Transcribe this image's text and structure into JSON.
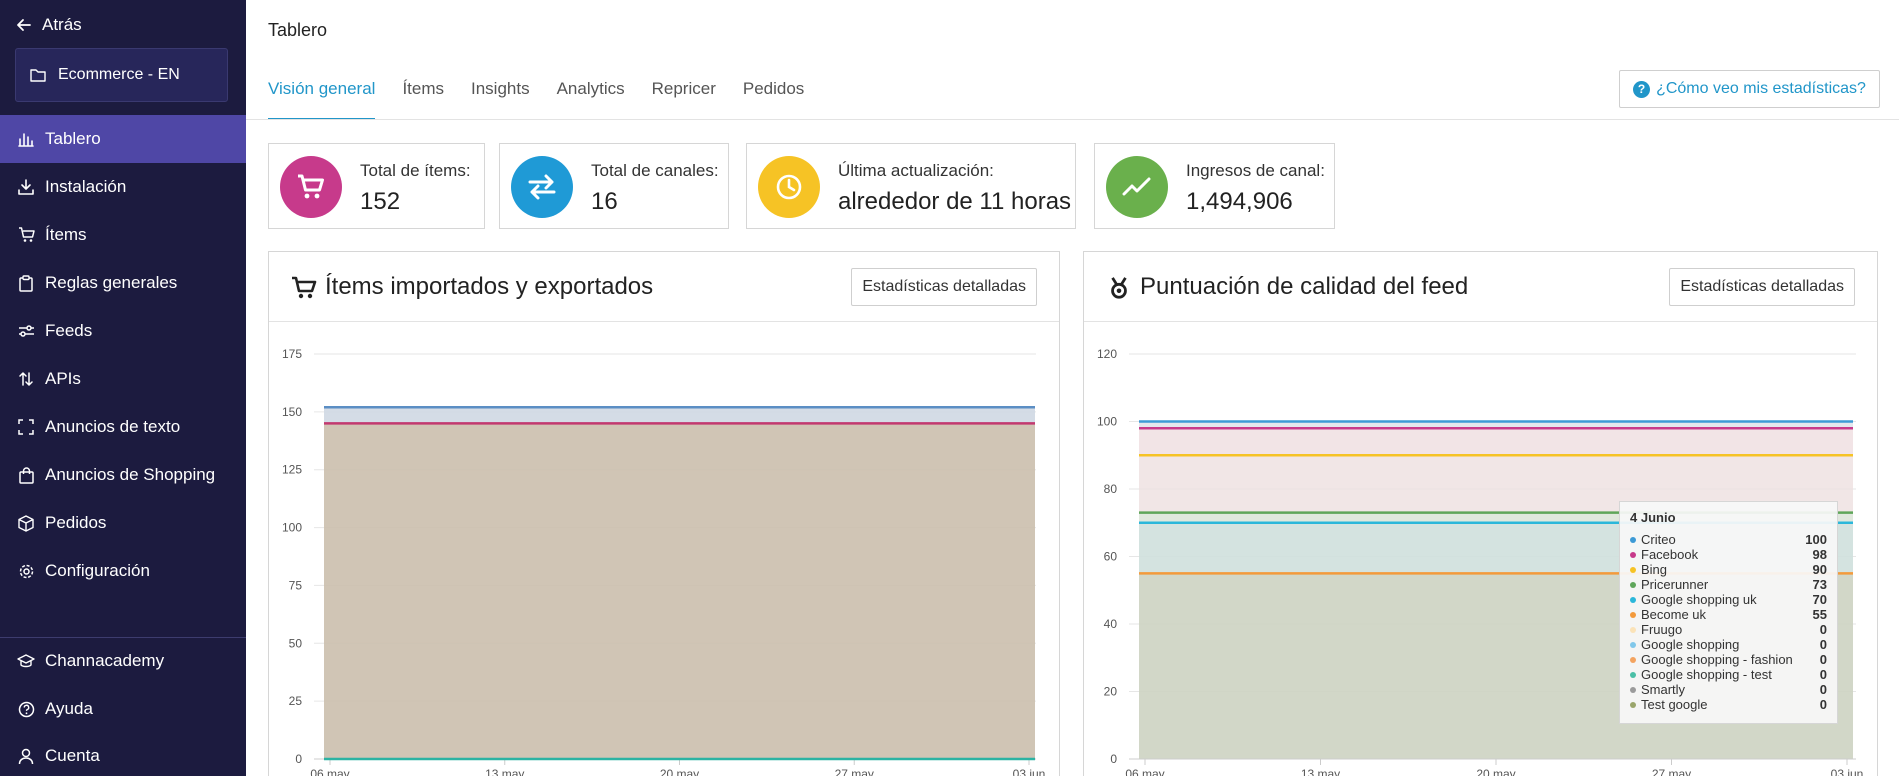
{
  "sidebar": {
    "back_label": "Atrás",
    "workspace": "Ecommerce - EN",
    "items": [
      {
        "label": "Tablero",
        "icon": "bar-chart-icon",
        "active": true
      },
      {
        "label": "Instalación",
        "icon": "download-icon"
      },
      {
        "label": "Ítems",
        "icon": "cart-icon"
      },
      {
        "label": "Reglas generales",
        "icon": "clipboard-icon"
      },
      {
        "label": "Feeds",
        "icon": "sliders-icon"
      },
      {
        "label": "APIs",
        "icon": "sort-arrows-icon"
      },
      {
        "label": "Anuncios de texto",
        "icon": "frame-icon"
      },
      {
        "label": "Anuncios de Shopping",
        "icon": "shopping-bag-icon"
      },
      {
        "label": "Pedidos",
        "icon": "box-icon"
      },
      {
        "label": "Configuración",
        "icon": "gear-icon"
      }
    ],
    "bottom_items": [
      {
        "label": "Channacademy",
        "icon": "graduation-cap-icon"
      },
      {
        "label": "Ayuda",
        "icon": "help-circle-icon"
      },
      {
        "label": "Cuenta",
        "icon": "user-icon"
      }
    ]
  },
  "header": {
    "title": "Tablero",
    "tabs": [
      {
        "label": "Visión general",
        "active": true
      },
      {
        "label": "Ítems"
      },
      {
        "label": "Insights"
      },
      {
        "label": "Analytics"
      },
      {
        "label": "Repricer"
      },
      {
        "label": "Pedidos"
      }
    ],
    "help_button": "¿Cómo veo mis estadísticas?"
  },
  "stats": [
    {
      "label": "Total de ítems:",
      "value": "152",
      "color": "#c73a8b",
      "icon": "cart-icon"
    },
    {
      "label": "Total de canales:",
      "value": "16",
      "color": "#1f9ad6",
      "icon": "swap-arrows-icon"
    },
    {
      "label": "Última actualización:",
      "value": "alrededor de 11 horas",
      "color": "#f6c325",
      "icon": "clock-icon"
    },
    {
      "label": "Ingresos de canal:",
      "value": "1,494,906",
      "color": "#6ab04c",
      "icon": "trend-icon"
    }
  ],
  "panels": {
    "items": {
      "title": "Ítems importados y exportados",
      "button": "Estadísticas detalladas"
    },
    "quality": {
      "title": "Puntuación de calidad del feed",
      "button": "Estadísticas detalladas"
    }
  },
  "chart_data": [
    {
      "type": "area",
      "title": "Ítems importados y exportados",
      "x_ticks": [
        "06 may",
        "13 may",
        "20 may",
        "27 may",
        "03 jun"
      ],
      "y_ticks": [
        0,
        25,
        50,
        75,
        100,
        125,
        150,
        175
      ],
      "ylim": [
        0,
        175
      ],
      "series": [
        {
          "values": [
            152,
            152,
            152,
            152,
            152
          ],
          "color": "#5b8ec4"
        },
        {
          "values": [
            145,
            145,
            145,
            145,
            145
          ],
          "color": "#c2396f"
        },
        {
          "values": [
            0,
            0,
            0,
            0,
            0
          ],
          "color": "#2bb3a3"
        }
      ],
      "grid": true
    },
    {
      "type": "area",
      "title": "Puntuación de calidad del feed",
      "x_ticks": [
        "06 may",
        "13 may",
        "20 may",
        "27 may",
        "03 jun"
      ],
      "y_ticks": [
        0,
        20,
        40,
        60,
        80,
        100,
        120
      ],
      "ylim": [
        0,
        120
      ],
      "series": [
        {
          "name": "Criteo",
          "value": 100,
          "color": "#3d9ad6"
        },
        {
          "name": "Facebook",
          "value": 98,
          "color": "#c73a8b"
        },
        {
          "name": "Bing",
          "value": 90,
          "color": "#f6c325"
        },
        {
          "name": "Pricerunner",
          "value": 73,
          "color": "#5fa65a"
        },
        {
          "name": "Google shopping uk",
          "value": 70,
          "color": "#2bb7da"
        },
        {
          "name": "Become uk",
          "value": 55,
          "color": "#f39a3c"
        },
        {
          "name": "Fruugo",
          "value": 0,
          "color": "#fbe3b8"
        },
        {
          "name": "Google shopping",
          "value": 0,
          "color": "#82c8ea"
        },
        {
          "name": "Google shopping - fashion",
          "value": 0,
          "color": "#f4a460"
        },
        {
          "name": "Google shopping - test",
          "value": 0,
          "color": "#4bbfa6"
        },
        {
          "name": "Smartly",
          "value": 0,
          "color": "#9b9b9b"
        },
        {
          "name": "Test google",
          "value": 0,
          "color": "#9aa56b"
        }
      ],
      "tooltip_title": "4 Junio",
      "grid": true
    }
  ]
}
